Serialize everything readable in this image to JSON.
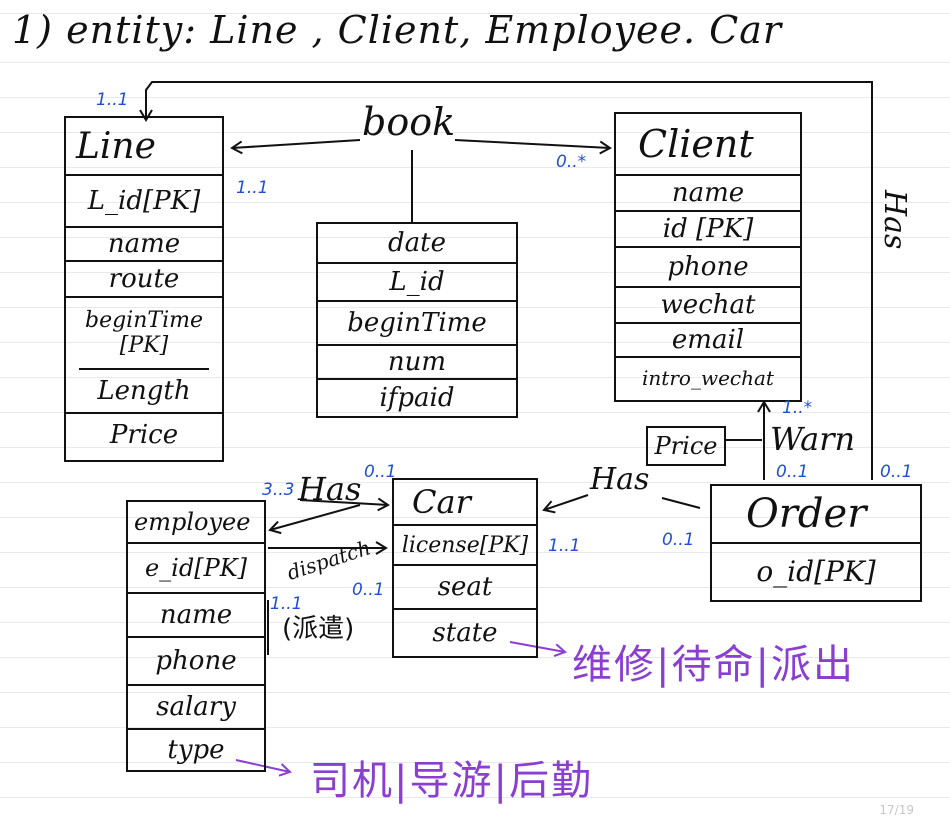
{
  "heading": "1) entity: Line , Client, Employee. Car",
  "entities": {
    "line": {
      "title": "Line",
      "attrs": [
        "L_id[PK]",
        "name",
        "route",
        "beginTime [PK]",
        "Length",
        "Price"
      ]
    },
    "book": {
      "attrs": [
        "date",
        "L_id",
        "beginTime",
        "num",
        "ifpaid"
      ]
    },
    "client": {
      "title": "Client",
      "attrs": [
        "name",
        "id [PK]",
        "phone",
        "wechat",
        "email",
        "intro_wechat"
      ]
    },
    "employee": {
      "title": "employee",
      "attrs": [
        "e_id[PK]",
        "name",
        "phone",
        "salary",
        "type"
      ]
    },
    "car": {
      "title": "Car",
      "attrs": [
        "license[PK]",
        "seat",
        "state"
      ]
    },
    "order": {
      "title": "Order",
      "attrs": [
        "o_id[PK]"
      ]
    },
    "price_box": "Price"
  },
  "relationships": {
    "book": "book",
    "has_right": "Has",
    "has_car": "Has",
    "has_employee": "Has",
    "warn": "Warn",
    "dispatch": "dispatch",
    "dispatch_cn": "(派遣)"
  },
  "cardinalities": {
    "line_top": "1..1",
    "line_book": "1..1",
    "client_book": "0..*",
    "client_warn": "1..*",
    "order_warn": "0..1",
    "order_has_right": "0..1",
    "order_has_car": "0..1",
    "car_has_order": "1..1",
    "car_has_emp": "0..1",
    "emp_has_car": "3..3",
    "emp_dispatch": "1..1",
    "car_dispatch": "0..1"
  },
  "notes": {
    "state_note": "维修|待命|派出",
    "type_note": "司机|导游|后勤"
  },
  "page_number": "17/19",
  "colors": {
    "ink": "#111111",
    "cardinality": "#1f4fd6",
    "note": "#8a3fd1"
  }
}
